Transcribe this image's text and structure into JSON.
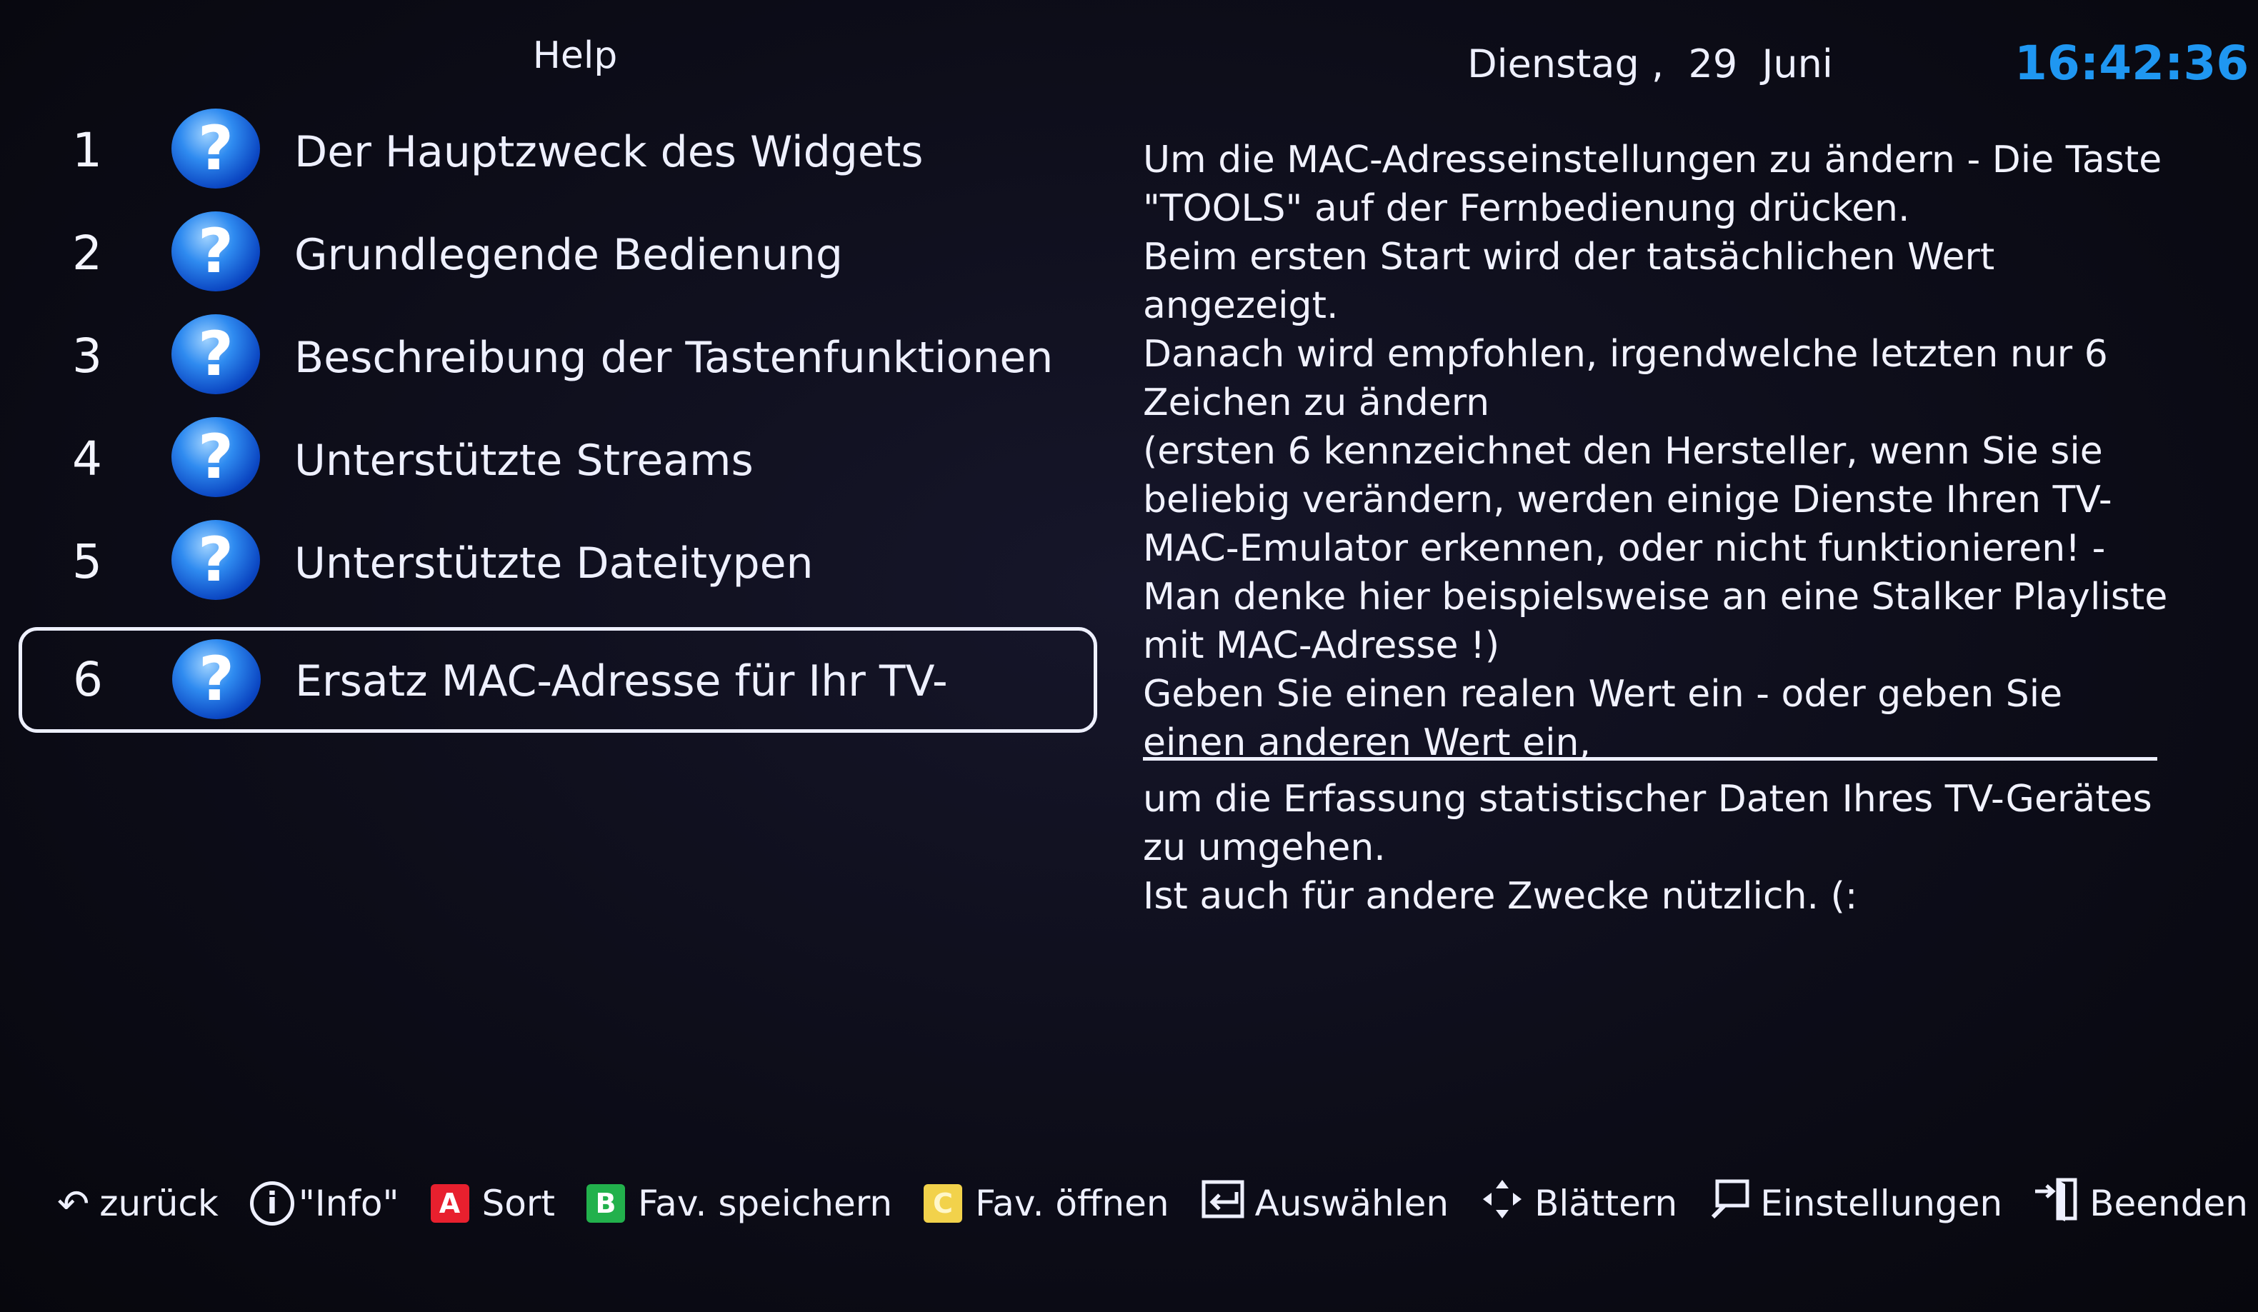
{
  "header": {
    "title": "Help",
    "date": "Dienstag ,  29  Juni",
    "time": "16:42:36"
  },
  "menu": {
    "items": [
      {
        "number": "1",
        "label": "Der Hauptzweck des Widgets"
      },
      {
        "number": "2",
        "label": "Grundlegende Bedienung"
      },
      {
        "number": "3",
        "label": "Beschreibung der Tastenfunktionen"
      },
      {
        "number": "4",
        "label": "Unterstützte Streams"
      },
      {
        "number": "5",
        "label": "Unterstützte Dateitypen"
      },
      {
        "number": "6",
        "label": "Ersatz MAC-Adresse für Ihr TV-"
      }
    ],
    "icon_glyph": "?",
    "selected_index": 5
  },
  "description": {
    "paragraphs": [
      "Um die MAC-Adresseinstellungen zu ändern - Die Taste \"TOOLS\" auf der Fernbedienung drücken.",
      "Beim ersten Start wird der tatsächlichen Wert angezeigt.",
      "Danach wird empfohlen, irgendwelche letzten nur 6 Zeichen zu ändern",
      "(ersten 6 kennzeichnet den Hersteller, wenn Sie sie beliebig verändern, werden einige Dienste Ihren TV-MAC-Emulator erkennen, oder nicht funktionieren! - Man denke hier beispielsweise an eine Stalker Playliste mit MAC-Adresse !)",
      "Geben Sie einen realen Wert ein - oder geben Sie einen anderen Wert ein,"
    ],
    "after_divider": [
      "um die Erfassung statistischer Daten Ihres TV-Gerätes zu umgehen.",
      "Ist auch für andere Zwecke nützlich. (:"
    ]
  },
  "footer": {
    "back": {
      "icon": "back-arrow-icon",
      "label": "zurück"
    },
    "info": {
      "icon": "info-icon",
      "glyph": "i",
      "label": "\"Info\""
    },
    "sort": {
      "key": "A",
      "label": "Sort"
    },
    "fav_save": {
      "key": "B",
      "label": "Fav. speichern"
    },
    "fav_open": {
      "key": "C",
      "label": "Fav. öffnen"
    },
    "select": {
      "icon": "enter-icon",
      "label": "Auswählen"
    },
    "scroll": {
      "icon": "dpad-icon",
      "label": "Blättern"
    },
    "settings": {
      "icon": "tools-icon",
      "label": "Einstellungen"
    },
    "exit": {
      "icon": "exit-icon",
      "label": "Beenden"
    }
  },
  "colors": {
    "clock": "#1f97f2",
    "key_a": "#e8202e",
    "key_b": "#22b14c",
    "key_c": "#f2d24b",
    "icon_blue": "#1a6fe0"
  }
}
